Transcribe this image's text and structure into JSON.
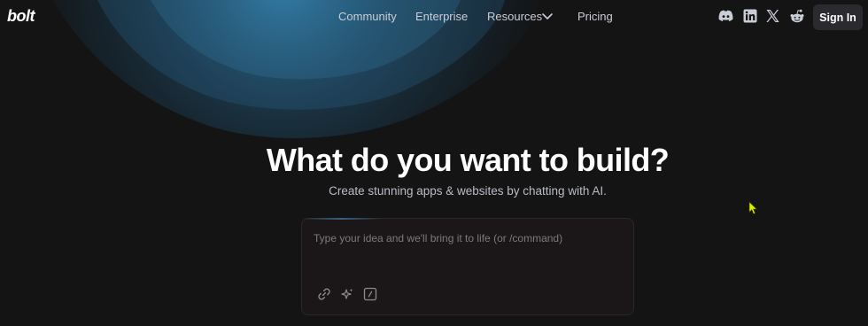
{
  "brand": {
    "logo_text": "bolt"
  },
  "nav": {
    "items": [
      {
        "label": "Community"
      },
      {
        "label": "Enterprise"
      },
      {
        "label": "Resources"
      },
      {
        "label": "Pricing"
      }
    ]
  },
  "social": {
    "icons": [
      "discord-icon",
      "linkedin-icon",
      "x-icon",
      "reddit-icon"
    ]
  },
  "auth": {
    "sign_in_label": "Sign In"
  },
  "hero": {
    "title": "What do you want to build?",
    "subtitle": "Create stunning apps & websites by chatting with AI."
  },
  "prompt": {
    "placeholder": "Type your idea and we'll bring it to life (or /command)",
    "value": "",
    "tools": [
      "link-icon",
      "sparkle-icon",
      "slash-command-icon"
    ]
  },
  "colors": {
    "background": "#141414",
    "glow": "#3a8fc0",
    "sign_in_bg": "#2b2b2f",
    "prompt_bg": "#1b1617",
    "cursor": "#d8f000"
  }
}
